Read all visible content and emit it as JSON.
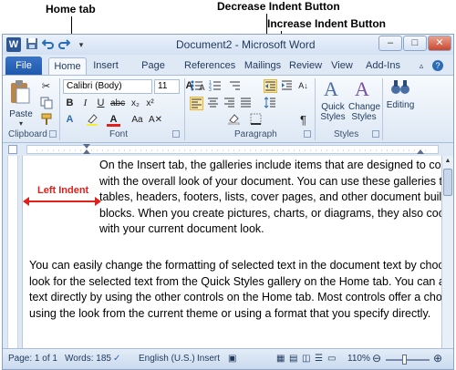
{
  "callouts": {
    "home_tab": "Home tab",
    "decrease_indent": "Decrease Indent Button",
    "increase_indent": "Increase Indent Button",
    "left_indent": "Left Indent"
  },
  "window": {
    "title": "Document2 - Microsoft Word",
    "controls": {
      "minimize": "–",
      "maximize": "□",
      "close": "✕"
    }
  },
  "tabs": {
    "file": "File",
    "home": "Home",
    "insert": "Insert",
    "page_layout": "Page Layout",
    "references": "References",
    "mailings": "Mailings",
    "review": "Review",
    "view": "View",
    "addins": "Add-Ins"
  },
  "ribbon": {
    "clipboard": {
      "label": "Clipboard",
      "paste": "Paste"
    },
    "font": {
      "label": "Font",
      "family": "Calibri (Body)",
      "size": "11",
      "bold": "B",
      "italic": "I",
      "underline": "U"
    },
    "paragraph": {
      "label": "Paragraph",
      "pilcrow": "¶"
    },
    "styles": {
      "label": "Styles",
      "quick_styles": "Quick Styles",
      "change_styles": "Change Styles"
    },
    "editing": {
      "label": "Editing"
    }
  },
  "document": {
    "para1": [
      "On the Insert tab, the galleries include items that are designed to coordinate",
      "with the overall look of your document.  You can use these galleries to insert",
      "tables, headers, footers, lists, cover pages, and other document building",
      "blocks. When you create pictures, charts, or diagrams, they also coordinate",
      "with your current document look."
    ],
    "para2": [
      "You can easily change the formatting of selected text in the document text by choosing a",
      "look for the selected text from the Quick Styles gallery on the Home tab. You can also format",
      "text directly by using the other controls on the Home tab. Most controls offer a choice of",
      "using the look from the current theme or using a format that you specify directly."
    ]
  },
  "status": {
    "page": "Page: 1 of 1",
    "words": "Words: 185",
    "language": "English (U.S.)",
    "mode": "Insert",
    "zoom": "110%"
  },
  "colors": {
    "accent": "#1e59ad",
    "callout_arrow": "#e0201b"
  }
}
